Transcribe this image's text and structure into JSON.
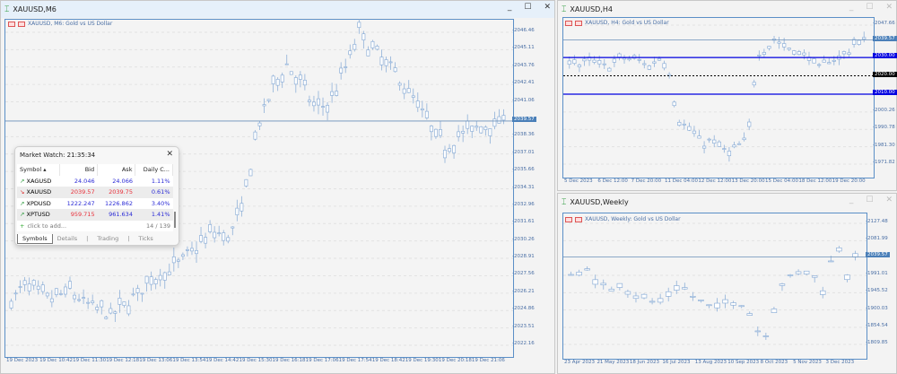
{
  "main_window": {
    "title": "XAUUSD,M6",
    "chart_title": "XAUUSD, M6:  Gold vs US Dollar",
    "price_ticks": [
      "2046.46",
      "2045.11",
      "2043.76",
      "2042.41",
      "2041.06",
      "2038.36",
      "2037.01",
      "2035.66",
      "2034.31",
      "2032.96",
      "2031.61",
      "2030.26",
      "2028.91",
      "2027.56",
      "2026.21",
      "2024.86",
      "2023.51",
      "2022.16"
    ],
    "current_price": "2039.57",
    "time_ticks": [
      "19 Dec 2023",
      "19 Dec 10:42",
      "19 Dec 11:30",
      "19 Dec 12:18",
      "19 Dec 13:06",
      "19 Dec 13:54",
      "19 Dec 14:42",
      "19 Dec 15:30",
      "19 Dec 16:18",
      "19 Dec 17:06",
      "19 Dec 17:54",
      "19 Dec 18:42",
      "19 Dec 19:30",
      "19 Dec 20:18",
      "19 Dec 21:06"
    ],
    "price_path": [
      2025.5,
      2027,
      2026,
      2025.8,
      2026.5,
      2025.5,
      2025,
      2024.5,
      2025.5,
      2026.5,
      2027.5,
      2028,
      2029,
      2030,
      2031,
      2030.5,
      2033,
      2039,
      2042,
      2044,
      2042.5,
      2040.5,
      2041,
      2043.5,
      2046.5,
      2045,
      2044,
      2042.5,
      2041,
      2039,
      2037.5,
      2038.5,
      2039,
      2039.3,
      2039.57
    ]
  },
  "h4_window": {
    "title": "XAUUSD,H4",
    "chart_title": "XAUUSD, H4:  Gold vs US Dollar",
    "price_ticks": [
      "2047.66",
      "2000.26",
      "1990.78",
      "1981.30",
      "1971.82"
    ],
    "current_price": "2039.57",
    "levels": [
      {
        "price": "2030.00",
        "color": "#0000e0",
        "style": "solid"
      },
      {
        "price": "2020.00",
        "color": "#000000",
        "style": "dashed"
      },
      {
        "price": "2010.00",
        "color": "#0000e0",
        "style": "solid"
      }
    ],
    "time_ticks": [
      "5 Dec 2023",
      "6 Dec 12:00",
      "7 Dec 20:00",
      "11 Dec 04:00",
      "12 Dec 12:00",
      "13 Dec 20:00",
      "15 Dec 04:00",
      "18 Dec 12:00",
      "19 Dec 20:00"
    ],
    "price_path": [
      2030,
      2026,
      2027,
      2028,
      2025,
      2027,
      2030,
      2029,
      2028,
      2025,
      2030,
      2027,
      1998,
      1992,
      1988,
      1983,
      1985,
      1980,
      1978,
      1982,
      1985,
      2032,
      2035,
      2040,
      2036,
      2034,
      2032,
      2030,
      2024,
      2028,
      2030,
      2032,
      2038,
      2039.57
    ]
  },
  "weekly_window": {
    "title": "XAUUSD,Weekly",
    "chart_title": "XAUUSD, Weekly:  Gold vs US Dollar",
    "price_ticks": [
      "2127.48",
      "2081.99",
      "1991.01",
      "1945.52",
      "1900.03",
      "1854.54",
      "1809.85"
    ],
    "current_price": "2039.57",
    "time_ticks": [
      "23 Apr 2023",
      "21 May 2023",
      "18 Jun 2023",
      "16 Jul 2023",
      "13 Aug 2023",
      "10 Sep 2023",
      "8 Oct 2023",
      "5 Nov 2023",
      "3 Dec 2023"
    ],
    "price_path": [
      2000,
      1990,
      2015,
      1975,
      1960,
      1950,
      1980,
      1958,
      1945,
      1930,
      1925,
      1915,
      1930,
      1955,
      1960,
      1945,
      1925,
      1915,
      1900,
      1920,
      1915,
      1925,
      1915,
      1880,
      1830,
      1845,
      1935,
      1980,
      1985,
      2000,
      2005,
      1980,
      1955,
      2030,
      2070,
      1995,
      2039.57
    ]
  },
  "market_watch": {
    "title": "Market Watch: 21:35:34",
    "columns": [
      "Symbol",
      "Bid",
      "Ask",
      "Daily C..."
    ],
    "rows": [
      {
        "symbol": "XAGUSD",
        "bid": "24.046",
        "ask": "24.066",
        "change": "1.11%",
        "dir": "up"
      },
      {
        "symbol": "XAUUSD",
        "bid": "2039.57",
        "ask": "2039.75",
        "change": "0.61%",
        "dir": "down"
      },
      {
        "symbol": "XPDUSD",
        "bid": "1222.247",
        "ask": "1226.862",
        "change": "3.40%",
        "dir": "up"
      },
      {
        "symbol": "XPTUSD",
        "bid": "959.715",
        "ask": "961.634",
        "change": "1.41%",
        "dir": "up"
      }
    ],
    "add_label": "click to add...",
    "count": "14 / 139",
    "tabs": [
      "Symbols",
      "Details",
      "Trading",
      "Ticks"
    ]
  },
  "colors": {
    "axis": "#5b8fc7",
    "candle": "#8fb0d8",
    "up_arrow": "#2a9a3a",
    "down_arrow": "#d33",
    "bid_down": "#e8303a",
    "value_blue": "#2b2bd6"
  }
}
